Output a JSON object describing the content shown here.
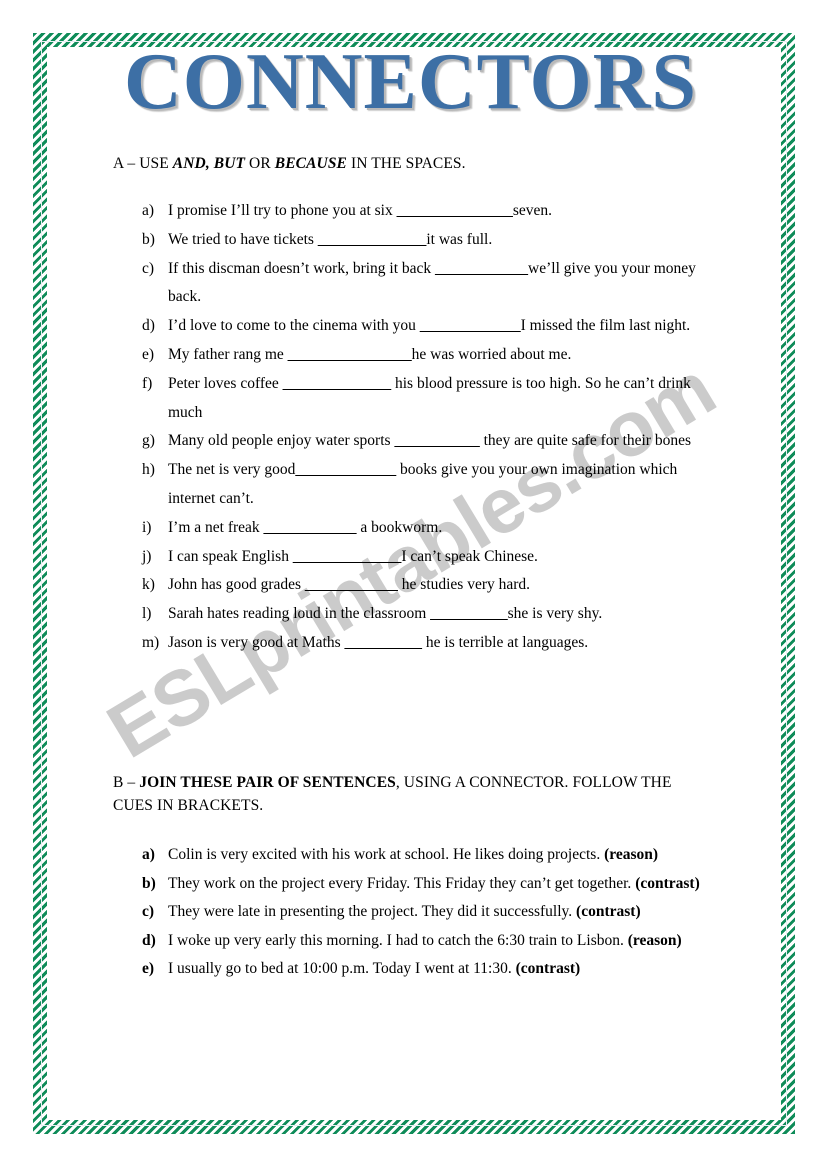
{
  "document": {
    "title": "CONNECTORS",
    "watermark": "ESLprintables.com",
    "colors": {
      "title_blue": "#3d6fa5",
      "title_shadow_gray": "#b9b9b9",
      "border_green": "#0f8c59",
      "watermark_gray": "#c9c9c9",
      "text_black": "#000000"
    }
  },
  "section_a": {
    "heading": {
      "prefix": "A – USE ",
      "bold_italic_1": "AND, BUT",
      "middle": " OR ",
      "bold_italic_2": "BECAUSE",
      "suffix": " IN THE SPACES."
    },
    "items": [
      {
        "marker": "a)",
        "before": "I promise I’ll try to phone you at six ",
        "blank": "_______________",
        "after": "seven."
      },
      {
        "marker": "b)",
        "before": "We tried to have tickets ",
        "blank": "______________",
        "after": "it was full."
      },
      {
        "marker": "c)",
        "before": "If this discman doesn’t work, bring it back ",
        "blank": "____________",
        "after": "we’ll give you your money back."
      },
      {
        "marker": "d)",
        "before": "I’d love to come to the cinema with you ",
        "blank": "_____________",
        "after": "I missed the film last night."
      },
      {
        "marker": "e)",
        "before": "My father rang me ",
        "blank": "________________",
        "after": "he was worried about me."
      },
      {
        "marker": "f)",
        "before": "Peter loves coffee ",
        "blank": "______________",
        "after": " his blood pressure is too high. So he can’t drink much"
      },
      {
        "marker": "g)",
        "before": "Many old people enjoy water sports ",
        "blank": "___________",
        "after": " they are quite safe for their bones"
      },
      {
        "marker": "h)",
        "before": "The net is very good",
        "blank": "_____________",
        "after": " books give you your own imagination which internet can’t."
      },
      {
        "marker": "i)",
        "before": "I’m a net freak ",
        "blank": "____________",
        "after": " a bookworm."
      },
      {
        "marker": "j)",
        "before": "I can speak English ",
        "blank": "______________",
        "after": "I can’t speak Chinese."
      },
      {
        "marker": "k)",
        "before": "John has good grades ",
        "blank": "____________",
        "after": " he studies very hard."
      },
      {
        "marker": "l)",
        "before": "Sarah hates reading loud in the classroom ",
        "blank": "__________",
        "after": "she is very shy."
      },
      {
        "marker": "m)",
        "before": "Jason is very good at Maths ",
        "blank": "__________",
        "after": " he is terrible at languages."
      }
    ]
  },
  "section_b": {
    "heading": {
      "prefix": "B – ",
      "bold": "JOIN THESE PAIR OF SENTENCES",
      "suffix": ", USING A CONNECTOR. FOLLOW THE CUES IN BRACKETS."
    },
    "items": [
      {
        "marker": "a)",
        "text": "Colin is very excited with his work at school. He likes doing projects. ",
        "cue": "(reason)"
      },
      {
        "marker": "b)",
        "text": "They work on the project every Friday. This Friday they can’t get together. ",
        "cue": "(contrast)"
      },
      {
        "marker": "c)",
        "text": "They were late in presenting the project. They did it successfully. ",
        "cue": "(contrast)"
      },
      {
        "marker": "d)",
        "text": "I woke up very early this morning. I had to catch the 6:30 train to Lisbon. ",
        "cue": "(reason)"
      },
      {
        "marker": "e)",
        "text": "I usually go to bed at 10:00 p.m. Today I went at 11:30. ",
        "cue": "(contrast)"
      }
    ]
  }
}
